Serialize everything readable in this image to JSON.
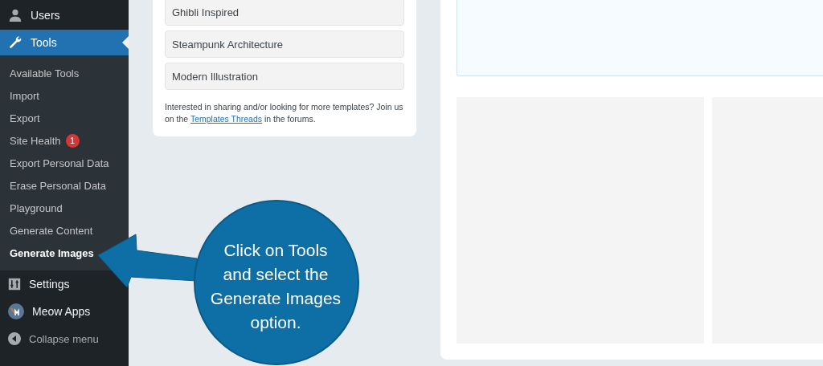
{
  "sidebar": {
    "items": [
      {
        "label": "Users",
        "selected": false
      },
      {
        "label": "Tools",
        "selected": true,
        "expanded": true,
        "children": [
          {
            "label": "Available Tools",
            "selected": false
          },
          {
            "label": "Import",
            "selected": false
          },
          {
            "label": "Export",
            "selected": false
          },
          {
            "label": "Site Health",
            "selected": false,
            "badge": "1"
          },
          {
            "label": "Export Personal Data",
            "selected": false
          },
          {
            "label": "Erase Personal Data",
            "selected": false
          },
          {
            "label": "Playground",
            "selected": false
          },
          {
            "label": "Generate Content",
            "selected": false
          },
          {
            "label": "Generate Images",
            "selected": true
          }
        ]
      },
      {
        "label": "Settings",
        "selected": false
      },
      {
        "label": "Meow Apps",
        "selected": false
      }
    ],
    "collapse": "Collapse menu"
  },
  "templates": {
    "items": [
      "Ghibli Inspired",
      "Steampunk Architecture",
      "Modern Illustration"
    ],
    "note": {
      "before": "Interested in sharing and/or looking for more templates? Join us on the ",
      "link": "Templates Threads",
      "after": " in the forums."
    }
  },
  "callout": {
    "text": "Click on Tools and select the Generate Images option."
  }
}
